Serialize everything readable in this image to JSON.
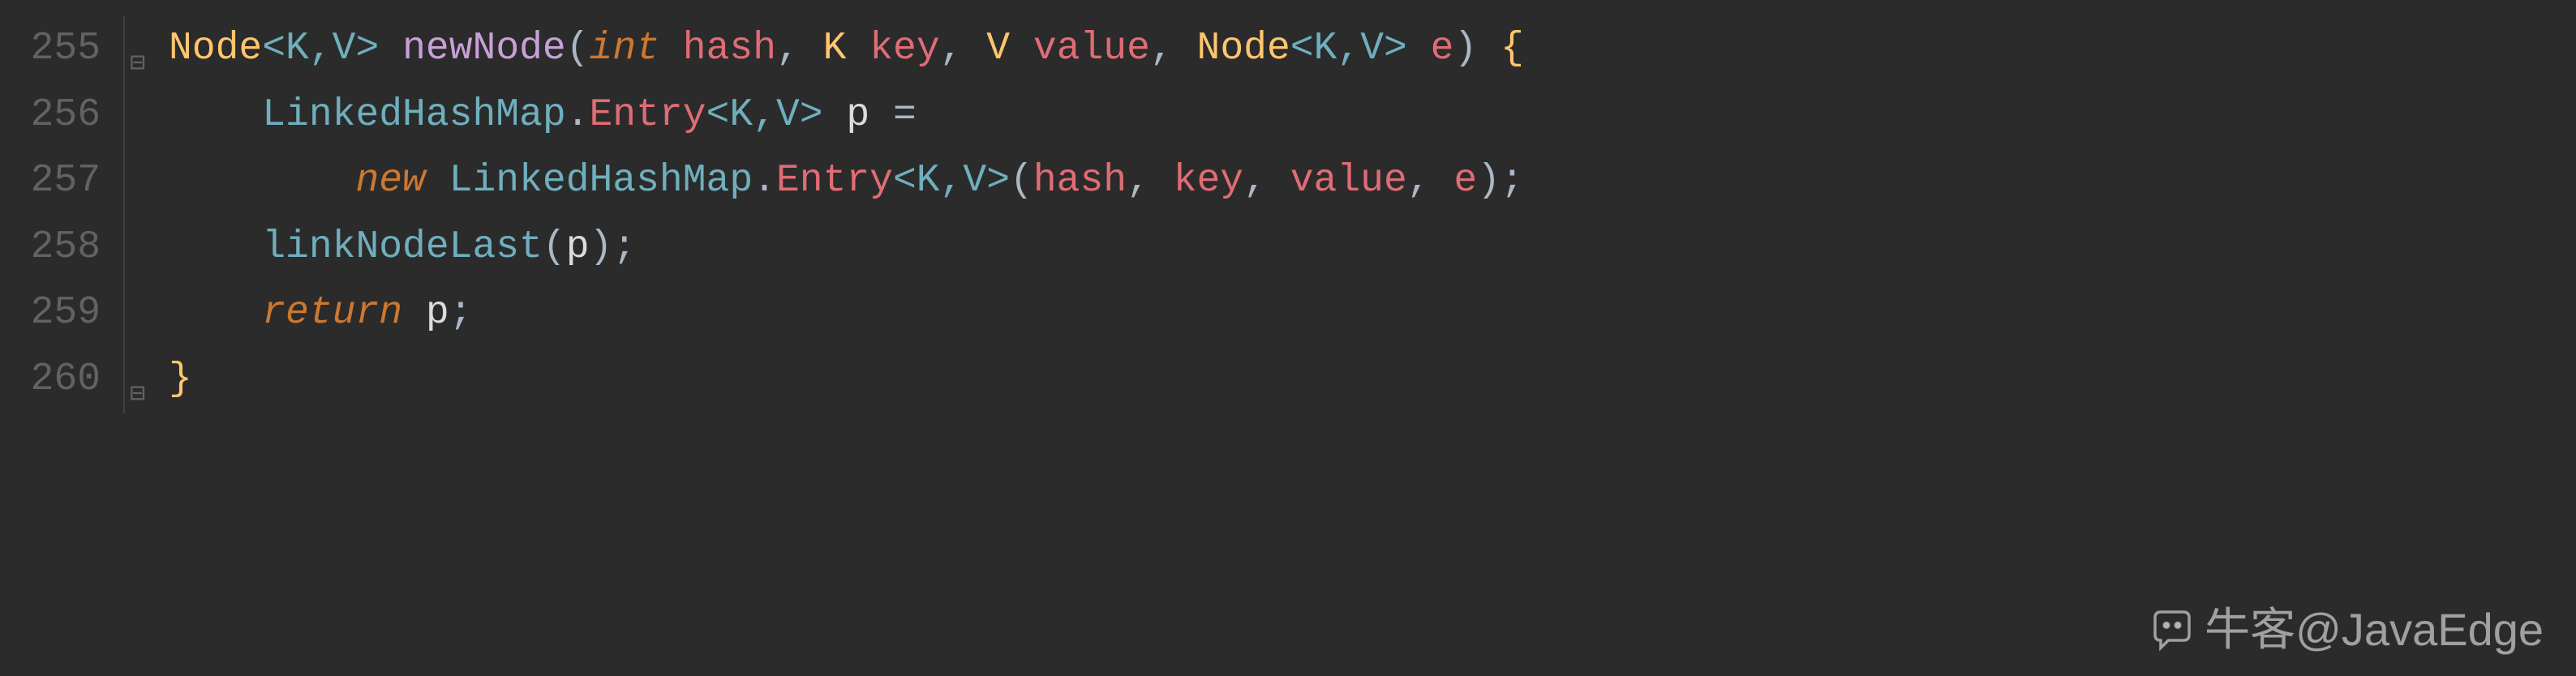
{
  "editor": {
    "lines": {
      "255": "255",
      "256": "256",
      "257": "257",
      "258": "258",
      "259": "259",
      "260": "260"
    },
    "code": {
      "l255": {
        "type1": "Node",
        "gen1a": "<",
        "gen1b": "K",
        "gen1c": ",",
        "gen1d": "V",
        "gen1e": ">",
        "sp1": " ",
        "method": "newNode",
        "paren1": "(",
        "kw_int": "int",
        "sp2": " ",
        "p_hash": "hash",
        "comma1": ", ",
        "type_k": "K",
        "sp3": " ",
        "p_key": "key",
        "comma2": ", ",
        "type_v": "V",
        "sp4": " ",
        "p_value": "value",
        "comma3": ", ",
        "type2": "Node",
        "gen2a": "<",
        "gen2b": "K",
        "gen2c": ",",
        "gen2d": "V",
        "gen2e": ">",
        "sp5": " ",
        "p_e": "e",
        "paren2": ")",
        "sp6": " ",
        "brace1": "{"
      },
      "l256": {
        "indent": "    ",
        "cls": "LinkedHashMap",
        "dot": ".",
        "inner": "Entry",
        "gen_a": "<",
        "gen_b": "K",
        "gen_c": ",",
        "gen_d": "V",
        "gen_e": ">",
        "sp": " ",
        "var": "p",
        "sp2": " ",
        "eq": "="
      },
      "l257": {
        "indent": "        ",
        "kw_new": "new",
        "sp": " ",
        "cls": "LinkedHashMap",
        "dot": ".",
        "inner": "Entry",
        "gen_a": "<",
        "gen_b": "K",
        "gen_c": ",",
        "gen_d": "V",
        "gen_e": ">",
        "paren1": "(",
        "a1": "hash",
        "c1": ", ",
        "a2": "key",
        "c2": ", ",
        "a3": "value",
        "c3": ", ",
        "a4": "e",
        "paren2": ")",
        "semi": ";"
      },
      "l258": {
        "indent": "    ",
        "call": "linkNodeLast",
        "paren1": "(",
        "arg": "p",
        "paren2": ")",
        "semi": ";"
      },
      "l259": {
        "indent": "    ",
        "kw": "return",
        "sp": " ",
        "var": "p",
        "semi": ";"
      },
      "l260": {
        "brace": "}"
      }
    }
  },
  "watermark": {
    "text": "牛客@JavaEdge"
  },
  "icons": {
    "override": "override-icon"
  }
}
